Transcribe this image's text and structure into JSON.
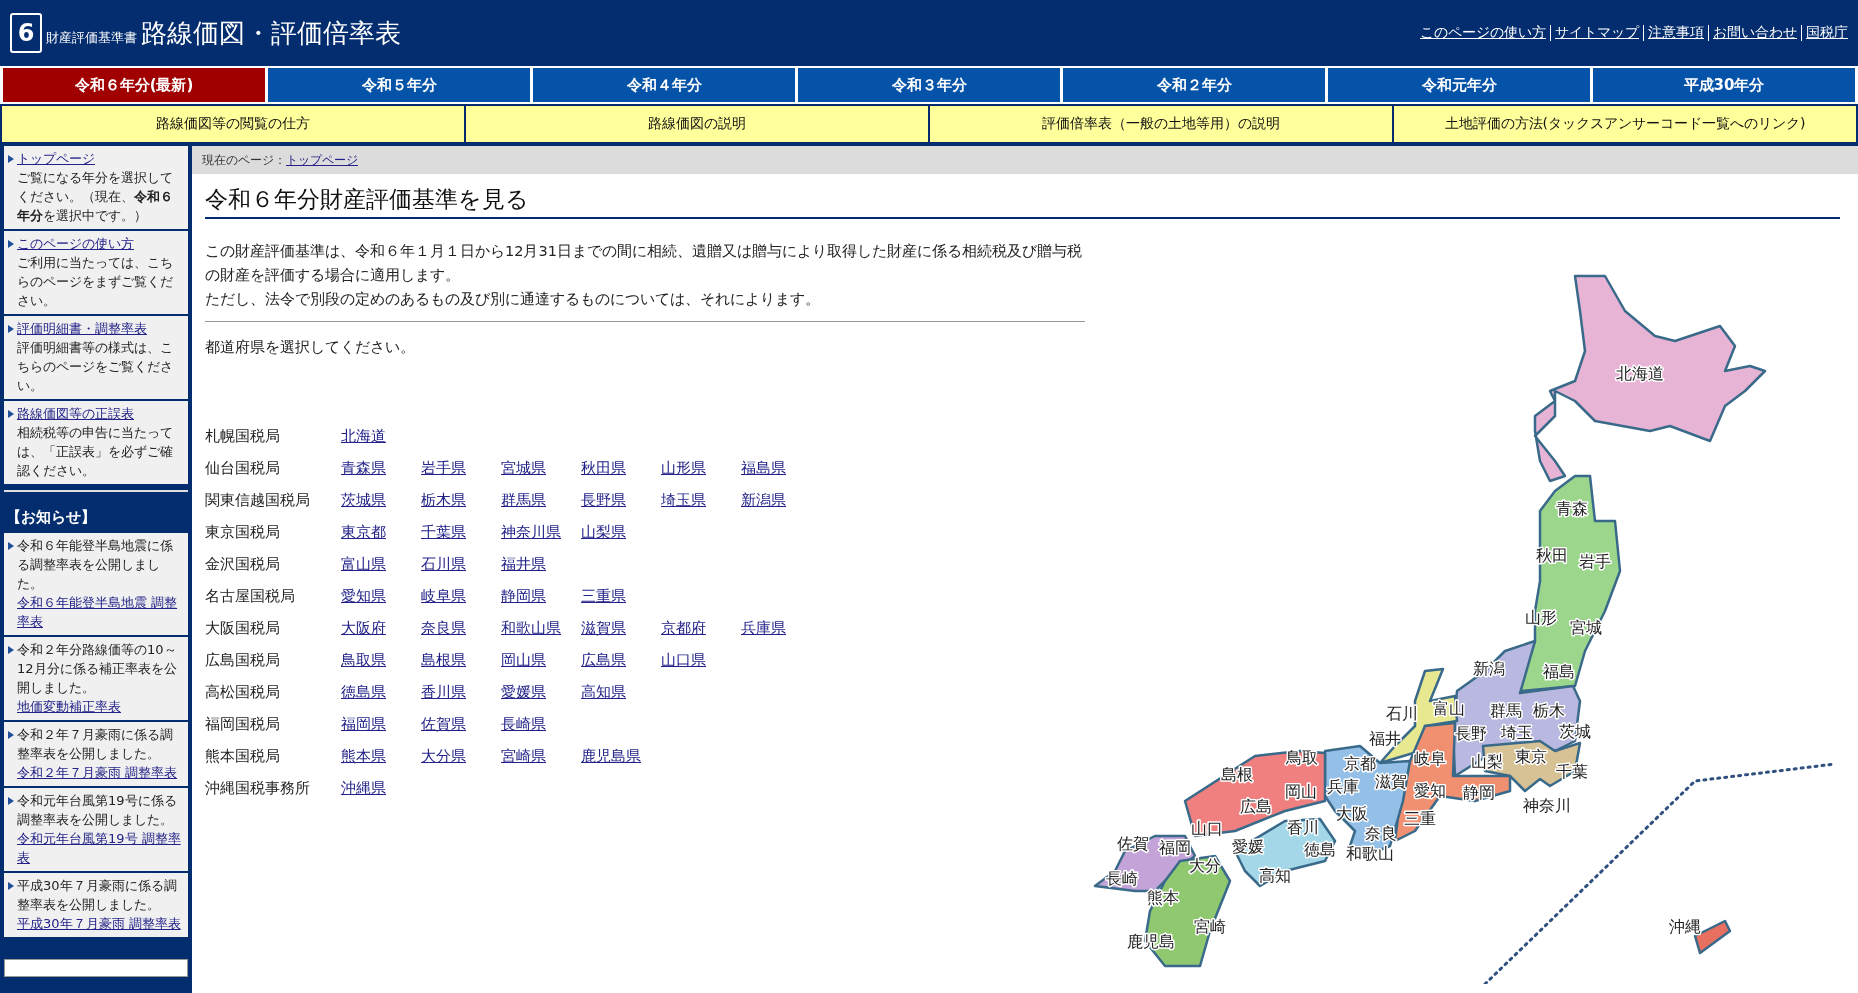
{
  "header": {
    "logo_number": "6",
    "subtitle": "財産評価基準書",
    "title": "路線価図・評価倍率表",
    "links": [
      "このページの使い方",
      "サイトマップ",
      "注意事項",
      "お問い合わせ",
      "国税庁"
    ]
  },
  "year_tabs": [
    {
      "label": "令和６年分(最新)",
      "selected": true
    },
    {
      "label": "令和５年分",
      "selected": false
    },
    {
      "label": "令和４年分",
      "selected": false
    },
    {
      "label": "令和３年分",
      "selected": false
    },
    {
      "label": "令和２年分",
      "selected": false
    },
    {
      "label": "令和元年分",
      "selected": false
    },
    {
      "label": "平成30年分",
      "selected": false
    }
  ],
  "guide_links": [
    "路線価図等の閲覧の仕方",
    "路線価図の説明",
    "評価倍率表（一般の土地等用）の説明",
    "土地評価の方法(タックスアンサーコード一覧へのリンク)"
  ],
  "sidebar": {
    "items": [
      {
        "link": "トップページ",
        "text": "ご覧になる年分を選択してください。（現在、**令和６年分**を選択中です。）"
      },
      {
        "link": "このページの使い方",
        "text": "ご利用に当たっては、こちらのページをまずご覧ください。"
      },
      {
        "link": "評価明細書・調整率表",
        "text": "評価明細書等の様式は、こちらのページをご覧ください。"
      },
      {
        "link": "路線価図等の正誤表",
        "text": "相続税等の申告に当たっては、「正誤表」を必ずご確認ください。"
      }
    ],
    "notice_title": "【お知らせ】",
    "notices": [
      {
        "text": "令和６年能登半島地震に係る調整率表を公開しました。",
        "link": "令和６年能登半島地震 調整率表"
      },
      {
        "text": "令和２年分路線価等の10～12月分に係る補正率表を公開しました。",
        "link": "地価変動補正率表"
      },
      {
        "text": "令和２年７月豪雨に係る調整率表を公開しました。",
        "link": "令和２年７月豪雨 調整率表"
      },
      {
        "text": "令和元年台風第19号に係る調整率表を公開しました。",
        "link": "令和元年台風第19号 調整率表"
      },
      {
        "text": "平成30年７月豪雨に係る調整率表を公開しました。",
        "link": "平成30年７月豪雨 調整率表"
      }
    ]
  },
  "breadcrumb": {
    "label": "現在のページ：",
    "link": "トップページ"
  },
  "heading": "令和６年分財産評価基準を見る",
  "intro": [
    "この財産評価基準は、令和６年１月１日から12月31日までの間に相続、遺贈又は贈与により取得した財産に係る相続税及び贈与税の財産を評価する場合に適用します。",
    "ただし、法令で別段の定めのあるもの及び別に通達するものについては、それによります。"
  ],
  "select_prompt": "都道府県を選択してください。",
  "bureaus": [
    {
      "name": "札幌国税局",
      "prefectures": [
        "北海道"
      ]
    },
    {
      "name": "仙台国税局",
      "prefectures": [
        "青森県",
        "岩手県",
        "宮城県",
        "秋田県",
        "山形県",
        "福島県"
      ]
    },
    {
      "name": "関東信越国税局",
      "prefectures": [
        "茨城県",
        "栃木県",
        "群馬県",
        "長野県",
        "埼玉県",
        "新潟県"
      ]
    },
    {
      "name": "東京国税局",
      "prefectures": [
        "東京都",
        "千葉県",
        "神奈川県",
        "山梨県"
      ]
    },
    {
      "name": "金沢国税局",
      "prefectures": [
        "富山県",
        "石川県",
        "福井県"
      ]
    },
    {
      "name": "名古屋国税局",
      "prefectures": [
        "愛知県",
        "岐阜県",
        "静岡県",
        "三重県"
      ]
    },
    {
      "name": "大阪国税局",
      "prefectures": [
        "大阪府",
        "奈良県",
        "和歌山県",
        "滋賀県",
        "京都府",
        "兵庫県"
      ]
    },
    {
      "name": "広島国税局",
      "prefectures": [
        "鳥取県",
        "島根県",
        "岡山県",
        "広島県",
        "山口県"
      ]
    },
    {
      "name": "高松国税局",
      "prefectures": [
        "徳島県",
        "香川県",
        "愛媛県",
        "高知県"
      ]
    },
    {
      "name": "福岡国税局",
      "prefectures": [
        "福岡県",
        "佐賀県",
        "長崎県"
      ]
    },
    {
      "name": "熊本国税局",
      "prefectures": [
        "熊本県",
        "大分県",
        "宮崎県",
        "鹿児島県"
      ]
    },
    {
      "name": "沖縄国税事務所",
      "prefectures": [
        "沖縄県"
      ]
    }
  ],
  "map": {
    "regions": [
      {
        "color": "#e8b4d6"
      },
      {
        "color": "#9cd68c"
      },
      {
        "color": "#b8b8e0"
      },
      {
        "color": "#d6c294"
      },
      {
        "color": "#e8e890"
      },
      {
        "color": "#f09070"
      },
      {
        "color": "#94c0e8"
      },
      {
        "color": "#f08080"
      },
      {
        "color": "#a4d8e8"
      },
      {
        "color": "#c4a4d8"
      },
      {
        "color": "#90c870"
      },
      {
        "color": "#e87060"
      }
    ],
    "labels": [
      "北海道",
      "青森",
      "秋田",
      "岩手",
      "山形",
      "宮城",
      "福島",
      "新潟",
      "石川",
      "富山",
      "群馬",
      "栃木",
      "茨城",
      "福井",
      "長野",
      "埼玉",
      "鳥取",
      "京都",
      "岐阜",
      "山梨",
      "東京",
      "島根",
      "千葉",
      "兵庫",
      "滋賀",
      "岡山",
      "愛知",
      "静岡",
      "神奈川",
      "広島",
      "大阪",
      "三重",
      "山口",
      "香川",
      "奈良",
      "佐賀",
      "福岡",
      "愛媛",
      "徳島",
      "和歌山",
      "大分",
      "長崎",
      "高知",
      "熊本",
      "宮崎",
      "鹿児島",
      "沖縄"
    ]
  }
}
